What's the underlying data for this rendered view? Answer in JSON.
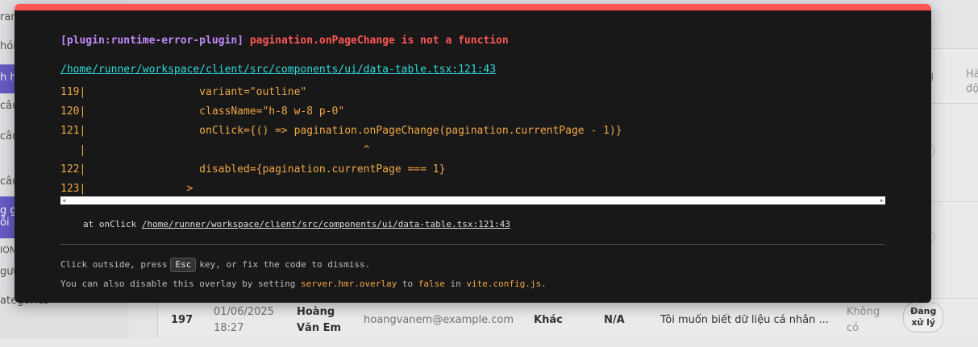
{
  "background": {
    "sidebar_items": [
      "ran",
      "hói",
      "h hò",
      "câu",
      "câu",
      "câu",
      "g g",
      "ỗi",
      "ION",
      "gườ",
      "ategories"
    ],
    "table_headers": [
      "g",
      "Hà",
      "độ"
    ],
    "last_row": {
      "id": "197",
      "date": "01/06/2025",
      "time": "18:27",
      "name_line1": "Hoàng",
      "name_line2": "Văn Em",
      "email": "hoangvanem@example.com",
      "category": "Khác",
      "priority": "N/A",
      "content": "Tôi muốn biết dữ liệu cá nhân ...",
      "attachment_line1": "Không",
      "attachment_line2": "có",
      "status_line1": "Đang",
      "status_line2": "xử lý",
      "menu": "..."
    },
    "row_fragments": [
      "ý",
      "ý"
    ],
    "row_menus": [
      "...",
      "..."
    ]
  },
  "overlay": {
    "plugin": "[plugin:runtime-error-plugin]",
    "message": "pagination.onPageChange is not a function",
    "file": "/home/runner/workspace/client/src/components/ui/data-table.tsx:121:43",
    "code_lines": [
      "119|                  variant=\"outline\"",
      "120|                  className=\"h-8 w-8 p-0\"",
      "121|                  onClick={() => pagination.onPageChange(pagination.currentPage - 1)}",
      "   |                                            ^",
      "122|                  disabled={pagination.currentPage === 1}",
      "123|                >"
    ],
    "stack_prefix": "at onClick",
    "stack_file": "/home/runner/workspace/client/src/components/ui/data-table.tsx:121:43",
    "tip1_pre": "Click outside, press",
    "tip1_key": "Esc",
    "tip1_post": "key, or fix the code to dismiss.",
    "tip2_pre": "You can also disable this overlay by setting",
    "tip2_setting": "server.hmr.overlay",
    "tip2_mid": "to",
    "tip2_value": "false",
    "tip2_in": "in",
    "tip2_file": "vite.config.js",
    "tip2_end": "."
  },
  "colors": {
    "accent_border": "#ff5555",
    "plugin": "#c28af9",
    "message": "#ff5757",
    "link": "#2fd8d8",
    "code": "#f0a747"
  }
}
